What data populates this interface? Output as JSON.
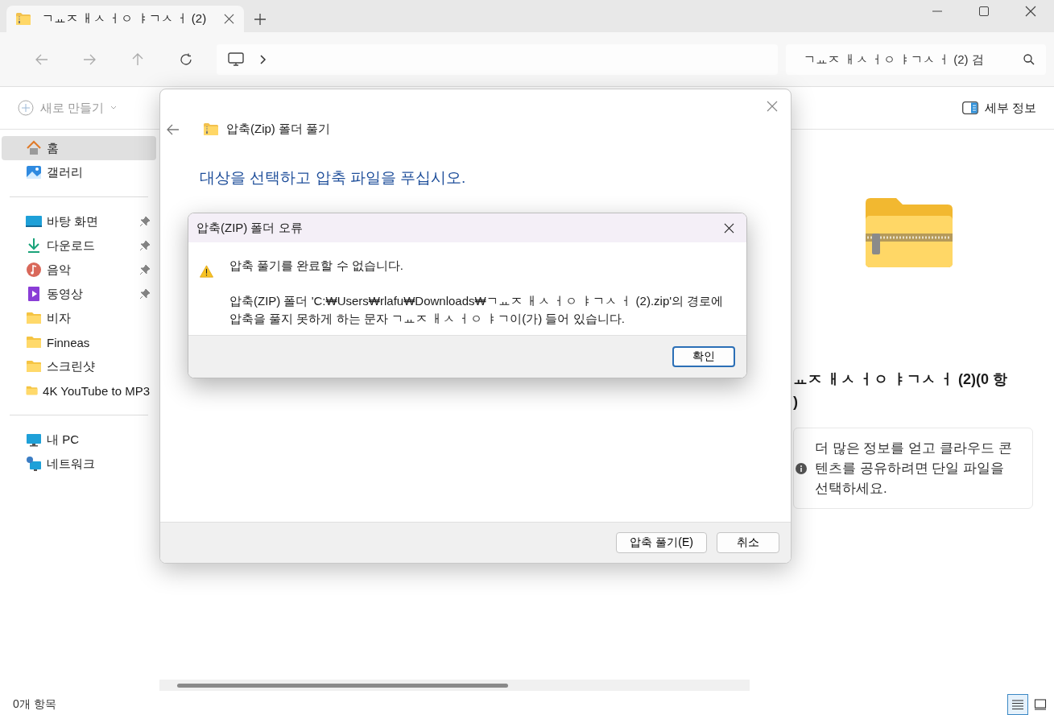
{
  "tab": {
    "title": "ㄱㅛㅈ ㅐㅅ ㅓㅇ ㅑㄱㅅ ㅓ (2)",
    "selected": true
  },
  "search": {
    "placeholder": "ㄱㅛㅈ ㅐㅅ ㅓㅇ ㅑㄱㅅ ㅓ (2) 검"
  },
  "command_bar": {
    "new_label": "새로 만들기",
    "new_disabled": true,
    "details_label": "세부 정보"
  },
  "sidebar": {
    "groups": [
      [
        {
          "label": "홈",
          "kind": "home",
          "pinned": false,
          "selected": true
        },
        {
          "label": "갤러리",
          "kind": "gallery",
          "pinned": false,
          "selected": false
        }
      ],
      [
        {
          "label": "바탕 화면",
          "kind": "desktop",
          "pinned": true,
          "selected": false
        },
        {
          "label": "다운로드",
          "kind": "download",
          "pinned": true,
          "selected": false
        },
        {
          "label": "음악",
          "kind": "music",
          "pinned": true,
          "selected": false
        },
        {
          "label": "동영상",
          "kind": "video",
          "pinned": true,
          "selected": false
        },
        {
          "label": "비자",
          "kind": "folder",
          "pinned": false,
          "selected": false
        },
        {
          "label": "Finneas",
          "kind": "folder",
          "pinned": false,
          "selected": false
        },
        {
          "label": "스크린샷",
          "kind": "folder",
          "pinned": false,
          "selected": false
        },
        {
          "label": "4K YouTube to MP3",
          "kind": "folder",
          "pinned": false,
          "selected": false
        }
      ],
      [
        {
          "label": "내 PC",
          "kind": "pc",
          "pinned": false,
          "selected": false
        },
        {
          "label": "네트워크",
          "kind": "network",
          "pinned": false,
          "selected": false
        }
      ]
    ]
  },
  "details": {
    "title_lines": [
      "ㅛㅈ ㅐㅅ ㅓㅇ ㅑㄱㅅ ㅓ (2)(0 항",
      ")"
    ],
    "info": "더 많은 정보를 얻고 클라우드 콘텐츠를 공유하려면 단일 파일을 선택하세요."
  },
  "status_bar": {
    "count": "0개 항목",
    "views": [
      {
        "kind": "details",
        "selected": true
      },
      {
        "kind": "tiles",
        "selected": false
      }
    ]
  },
  "wizard": {
    "title": "압축(Zip) 폴더 풀기",
    "heading": "대상을 선택하고 압축 파일을 푸십시오.",
    "buttons": [
      {
        "label": "압축 풀기(E)",
        "focused": false
      },
      {
        "label": "취소",
        "focused": false
      }
    ]
  },
  "error_dialog": {
    "title": "압축(ZIP) 폴더 오류",
    "message": "압축 풀기를 완료할 수 없습니다.",
    "detail": "압축(ZIP) 폴더 'C:₩Users₩rlafu₩Downloads₩ㄱㅛㅈ ㅐㅅ ㅓㅇ ㅑㄱㅅ ㅓ (2).zip'의 경로에 압축을 풀지 못하게 하는 문자 ㄱㅛㅈ ㅐㅅ ㅓㅇ ㅑㄱ이(가) 들어 있습니다.",
    "button": {
      "label": "확인",
      "focused": true
    }
  }
}
